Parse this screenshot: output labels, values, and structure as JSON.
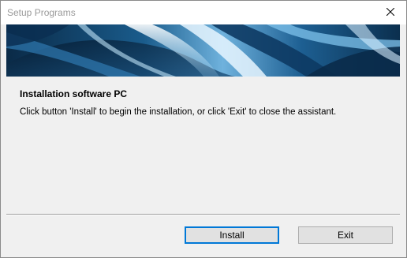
{
  "window": {
    "title": "Setup Programs"
  },
  "icons": {
    "close": "close-icon"
  },
  "main": {
    "heading": "Installation software PC",
    "description": "Click button 'Install' to begin the installation, or click 'Exit' to close the assistant."
  },
  "buttons": {
    "install_label": "Install",
    "exit_label": "Exit"
  },
  "colors": {
    "focus_border": "#0078d7",
    "banner_dark": "#0b2f4e",
    "banner_light": "#c9e6f7"
  }
}
